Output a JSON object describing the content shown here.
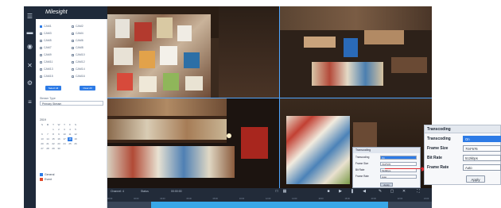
{
  "app": {
    "brand": "Milesight"
  },
  "rail": {
    "items": [
      {
        "icon": "menu-icon",
        "label": ""
      },
      {
        "icon": "live-view-icon",
        "label": ""
      },
      {
        "icon": "playback-icon",
        "label": ""
      },
      {
        "icon": "tools-icon",
        "label": ""
      },
      {
        "icon": "settings-icon",
        "label": ""
      },
      {
        "icon": "list-icon",
        "label": ""
      }
    ]
  },
  "channel_panel": {
    "channels": [
      "CAM1",
      "CAM2",
      "CAM3",
      "CAM4",
      "CAM5",
      "CAM6",
      "CAM7",
      "CAM8",
      "CAM9",
      "CAM10",
      "CAM11",
      "CAM12",
      "CAM13",
      "CAM14",
      "CAM15",
      "CAM16"
    ],
    "buttons": {
      "left": "Select All",
      "right": "Clear All"
    },
    "stream_label": "Stream Type",
    "stream_value": "Primary Stream",
    "calendar": {
      "month": "2019",
      "weekdays": [
        "S",
        "M",
        "T",
        "W",
        "T",
        "F",
        "S"
      ]
    },
    "legend": [
      {
        "label": "General",
        "color": "#2d7be6"
      },
      {
        "label": "Event",
        "color": "#e24a2a"
      }
    ]
  },
  "bottom_bar": {
    "left_label": "Channel: 4",
    "mid_label": "Status",
    "time_label": "00:00:00",
    "ticks": [
      "00:00",
      "02:00",
      "04:00",
      "06:00",
      "08:00",
      "10:00",
      "12:00",
      "14:00",
      "16:00",
      "18:00",
      "20:00",
      "22:00",
      "24:00"
    ],
    "progress": 0.73
  },
  "popup_small": {
    "title": "Transcoding",
    "rows": [
      {
        "label": "Transcoding",
        "value": "On"
      },
      {
        "label": "Frame Size",
        "value": "704*576"
      },
      {
        "label": "Bit Rate",
        "value": "512kbps"
      },
      {
        "label": "Frame Rate",
        "value": "Auto"
      }
    ],
    "apply": "Apply"
  },
  "callout": {
    "title": "Transcoding",
    "rows": [
      {
        "label": "Transcoding",
        "value": "On"
      },
      {
        "label": "Frame Size",
        "value": "704*576"
      },
      {
        "label": "Bit Rate",
        "value": "512kbps"
      },
      {
        "label": "Frame Rate",
        "value": "Auto"
      }
    ],
    "apply": "Apply"
  },
  "colors": {
    "accent": "#2d7be6",
    "arrow": "#e0282e",
    "timeline_fill": "#38a7e8"
  }
}
